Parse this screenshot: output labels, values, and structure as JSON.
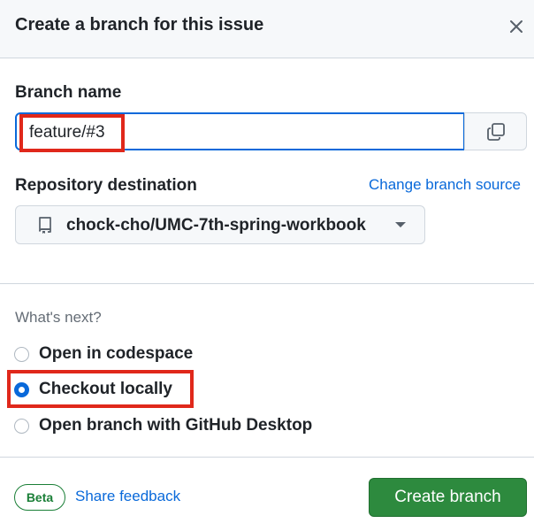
{
  "dialog": {
    "title": "Create a branch for this issue",
    "close_icon": "close-icon"
  },
  "branch": {
    "label": "Branch name",
    "value": "feature/#3",
    "copy_icon": "copy-icon"
  },
  "repository": {
    "label": "Repository destination",
    "change_source_link": "Change branch source",
    "selected": "chock-cho/UMC-7th-spring-workbook",
    "repo_icon": "repo-icon"
  },
  "whats_next": {
    "heading": "What's next?",
    "options": [
      {
        "label": "Open in codespace",
        "checked": false
      },
      {
        "label": "Checkout locally",
        "checked": true
      },
      {
        "label": "Open branch with GitHub Desktop",
        "checked": false
      }
    ]
  },
  "footer": {
    "beta_badge": "Beta",
    "feedback_link": "Share feedback",
    "create_button": "Create branch"
  },
  "colors": {
    "accent_blue": "#0969da",
    "primary_green": "#2d8a3e",
    "highlight_red": "#e0281b"
  }
}
